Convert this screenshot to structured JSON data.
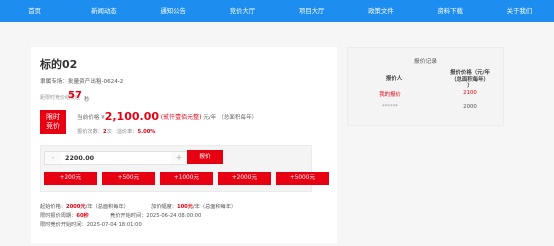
{
  "nav": {
    "items": [
      "首页",
      "新闻动态",
      "通知公告",
      "竞价大厅",
      "项目大厅",
      "政策文件",
      "资料下载",
      "关于我们"
    ]
  },
  "lot": {
    "title": "标的02",
    "session": "隶属专场：批量资产出租-0624-2",
    "countdown_label": "距限时竞价结束还",
    "countdown_value": "57",
    "countdown_unit": "秒"
  },
  "price": {
    "badge_line1": "限时",
    "badge_line2": "竞价",
    "current_label": "当前价格 ¥",
    "current_value": "2,100.00",
    "current_cn": "(贰仟壹佰元整)",
    "current_unit": "元/年 （总面积每年）",
    "bid_count_label": "报价次数：",
    "bid_count": "2",
    "bid_count_unit": "次",
    "premium_label": "溢价率：",
    "premium": "5.00%"
  },
  "bid": {
    "minus": "-",
    "value": "2200.00",
    "plus": "+",
    "submit": "报价",
    "quick": [
      "+200元",
      "+500元",
      "+1000元",
      "+2000元",
      "+5000元"
    ]
  },
  "rules": {
    "start_price_label": "起始价格：",
    "start_price": "2000元",
    "start_price_unit": "/年（总面积每年）",
    "increment_label": "加价幅度：",
    "increment": "100元",
    "increment_unit": "/年（总面积每年）",
    "cycle_label": "限时报价周期：",
    "cycle": "60秒",
    "open_time": "竞价开始时间：2025-06-24 08:00:00",
    "limit_start": "限时竞价开始时间：2025-07-04 18:01:00"
  },
  "history": {
    "title": "报价记录",
    "col_bidder": "报价人",
    "col_price_line1": "报价价格（元/年",
    "col_price_line2": "（总面积每年）",
    "col_price_line3": "）",
    "rows": [
      {
        "bidder": "我的报价",
        "price": "2100"
      },
      {
        "bidder": "******",
        "price": "2000"
      }
    ]
  },
  "colors": {
    "nav_bg": "#1d8df0",
    "accent_red": "#e60012"
  }
}
